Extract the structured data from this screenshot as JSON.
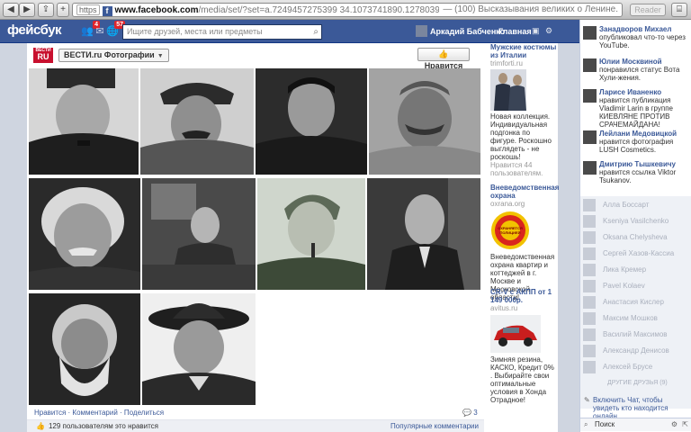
{
  "browser": {
    "url_protocol": "https",
    "url_domain": "www.facebook.com",
    "url_path": "/media/set/?set=a.7249457275399 34.1073741890.127803987254114&type=1",
    "page_title": "(100) Высказывания великих о Ленине.",
    "reader_label": "Reader"
  },
  "fb": {
    "logo": "фейсбук",
    "search_placeholder": "Ищите друзей, места или предметы",
    "friend_requests_count": "4",
    "notifications_count": "57",
    "user_name": "Аркадий Бабченко",
    "home_label": "Главная"
  },
  "page": {
    "logo_top": "ВЕСТИ",
    "logo_bottom": "RU",
    "name_crumb": "ВЕСТИ.ru",
    "section_crumb": "Фотографии",
    "like_button": "Нравится",
    "actions": "Нравится · Комментарий · Поделиться",
    "comment_count": "3",
    "likes_text": "129 пользователям это нравится",
    "popular_comments": "Популярные комментарии"
  },
  "photos": [
    {
      "label": "portrait-1"
    },
    {
      "label": "portrait-2"
    },
    {
      "label": "portrait-3"
    },
    {
      "label": "portrait-4"
    },
    {
      "label": "portrait-5"
    },
    {
      "label": "portrait-6"
    },
    {
      "label": "portrait-7"
    },
    {
      "label": "portrait-8"
    },
    {
      "label": "portrait-9"
    },
    {
      "label": "portrait-10"
    }
  ],
  "ads": [
    {
      "title": "Мужские костюмы из Италии",
      "url": "trimforti.ru",
      "body": "Новая коллекция. Индивидуальная подгонка по фигуре. Роскошно выглядеть - не роскошь!",
      "likes": "Нравится 44 пользователям."
    },
    {
      "title": "Вневедомственная охрана",
      "url": "oxrana.org",
      "stamp": "ОХРАНЯЕТСЯ ПОЛИЦИЕЙ",
      "body": "Вневедомственная охрана квартир и коттеджей в г. Москве и Московской области!"
    },
    {
      "title": "CR-V с АКПП от 1 149 000р.",
      "url": "avitus.ru",
      "body": "Зимняя резина, КАСКО, Кредит 0% . Выбирайте свои оптимальные условия в Хонда Отрадное!"
    }
  ],
  "ticker": [
    {
      "name": "Занадворов Михаел",
      "text": "опубликовал что-то через YouTube."
    },
    {
      "name": "Юлии Москвиной",
      "text": "понравился статус Вота Хули-жения."
    },
    {
      "name": "Ларисе Иваненко",
      "text": "нравится публикация Vladimir Larin в группе КИЕВЛЯНЕ ПРОТИВ СРАЧЕМАЙДАНА!"
    },
    {
      "name": "Лейлани Медовицкой",
      "text": "нравится фотография LUSH Cosmetics."
    },
    {
      "name": "Дмитрию Тышкевичу",
      "text": "нравится ссылка Viktor Tsukanov."
    }
  ],
  "chat_friends": [
    "Алла Боссарт",
    "Kseniya Vasilchenko",
    "Oksana Chelysheva",
    "Сергей Хазов-Кассиа",
    "Лика Кремер",
    "Pavel Kolaev",
    "Анастасия Кислер",
    "Максим Мошков",
    "Василий Максимов",
    "Александр Денисов",
    "Алексей Брусе"
  ],
  "chat": {
    "more": "ДРУГИЕ ДРУЗЬЯ (9)",
    "note": "Включить Чат, чтобы увидеть кто находится онлайн.",
    "search": "Поиск"
  },
  "colors": {
    "fb_blue": "#3b5998",
    "link": "#3b5998",
    "badge_red": "#e0242b",
    "vesti_red": "#c8102e"
  }
}
